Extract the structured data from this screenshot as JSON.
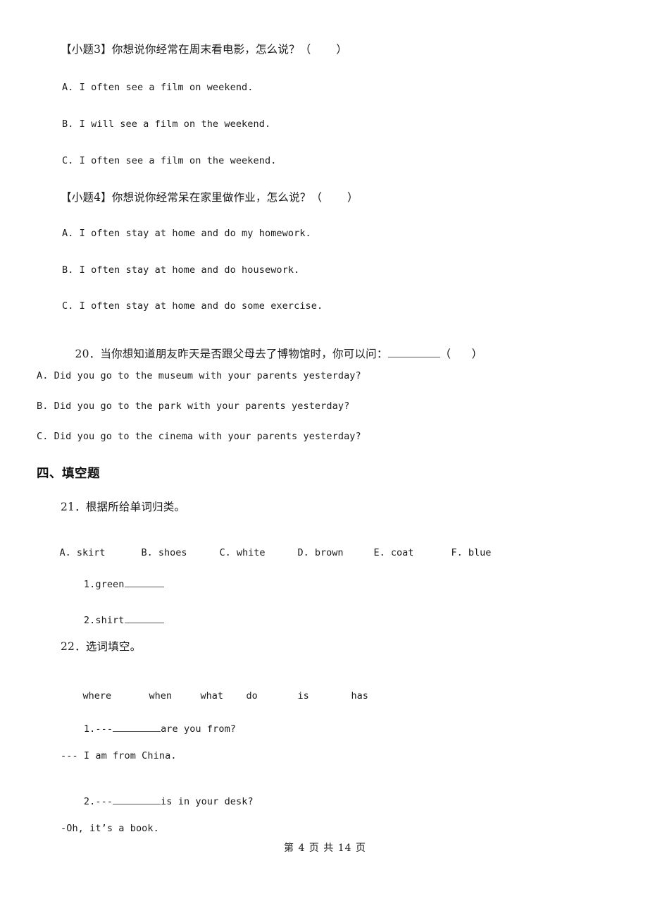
{
  "document": {
    "type": "exam-paper",
    "language": "zh-CN/en",
    "footer": "第 4 页 共 14 页"
  },
  "questions": [
    {
      "id": "sub-3",
      "stem": "【小题3】你想说你经常在周末看电影，怎么说？（       ）",
      "options": [
        "A. I often see a film on weekend.",
        "B. I will see a film on the weekend.",
        "C. I often see a film on the weekend."
      ]
    },
    {
      "id": "sub-4",
      "stem": "【小题4】你想说你经常呆在家里做作业，怎么说？（       ）",
      "options": [
        "A. I often stay at home and do my homework.",
        "B. I often stay at home and do housework.",
        "C. I often stay at home and do some exercise."
      ]
    },
    {
      "id": "q20",
      "stem_prefix": "20．当你想知道朋友昨天是否跟父母去了博物馆时，你可以问：",
      "stem_suffix": "（      ）",
      "options": [
        "A. Did you go to the museum with your parents yesterday?",
        "B. Did you go to the park with your parents yesterday?",
        "C. Did you go to the cinema with your parents yesterday?"
      ]
    }
  ],
  "section4": {
    "heading": "四、填空题",
    "q21": {
      "stem": "21．根据所给单词归类。",
      "word_bank": [
        "A. skirt",
        "B. shoes",
        "C. white",
        "D. brown",
        "E. coat",
        "F. blue"
      ],
      "items": [
        {
          "label": "1.green"
        },
        {
          "label": "2.shirt"
        }
      ]
    },
    "q22": {
      "stem": "22．选词填空。",
      "word_bank": [
        "where",
        "when",
        "what",
        "do",
        "is",
        "has"
      ],
      "dialogue": [
        {
          "number": "1.---",
          "after_blank": "are you from?"
        },
        {
          "answer": "--- I am from China."
        },
        {
          "number": "2.---",
          "after_blank": "is in your desk?"
        },
        {
          "answer": "-Oh, it’s a book."
        }
      ]
    }
  }
}
